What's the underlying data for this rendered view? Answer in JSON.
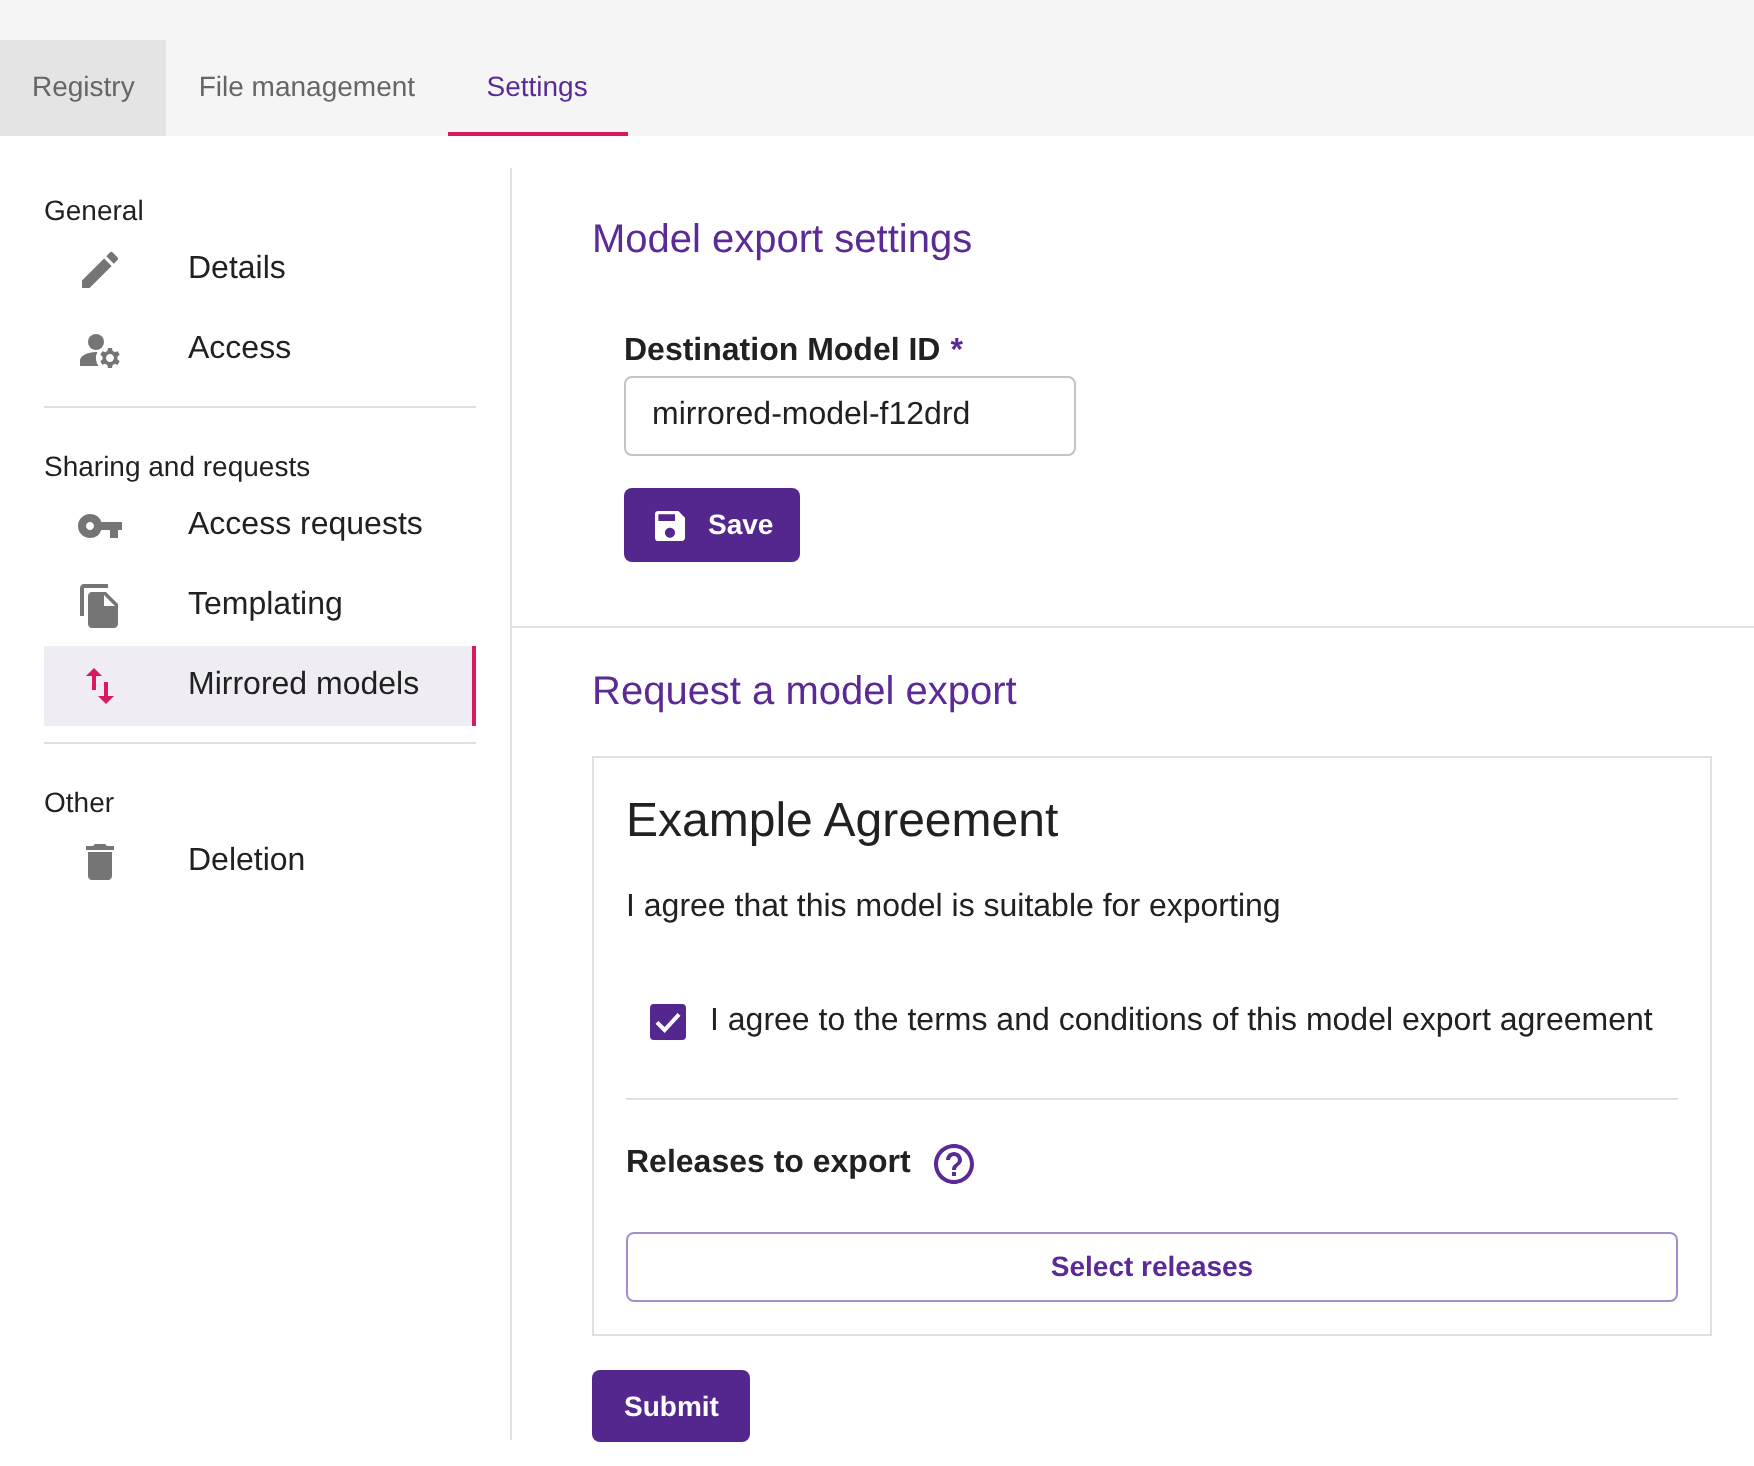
{
  "tabs": [
    {
      "label": "Registry",
      "selected": false,
      "hovered": true
    },
    {
      "label": "File management",
      "selected": false,
      "hovered": false
    },
    {
      "label": "Settings",
      "selected": true,
      "hovered": false
    }
  ],
  "sidebar": {
    "sections": [
      {
        "heading": "General",
        "items": [
          {
            "label": "Details",
            "selected": false
          },
          {
            "label": "Access",
            "selected": false
          }
        ]
      },
      {
        "heading": "Sharing and requests",
        "items": [
          {
            "label": "Access requests",
            "selected": false
          },
          {
            "label": "Templating",
            "selected": false
          },
          {
            "label": "Mirrored models",
            "selected": true
          }
        ]
      },
      {
        "heading": "Other",
        "items": [
          {
            "label": "Deletion",
            "selected": false
          }
        ]
      }
    ]
  },
  "export_settings": {
    "title": "Model export settings",
    "field": {
      "label": "Destination Model ID",
      "required_mark": "*",
      "value": "mirrored-model-f12drd"
    },
    "save_button": "Save"
  },
  "request_export": {
    "title": "Request a model export",
    "agreement": {
      "title": "Example Agreement",
      "text": "I agree that this model is suitable for exporting",
      "checkbox": {
        "label": "I agree to the terms and conditions of this model export agreement",
        "checked": true
      }
    },
    "releases": {
      "label": "Releases to export",
      "select_button": "Select releases"
    },
    "submit_button": "Submit"
  }
}
